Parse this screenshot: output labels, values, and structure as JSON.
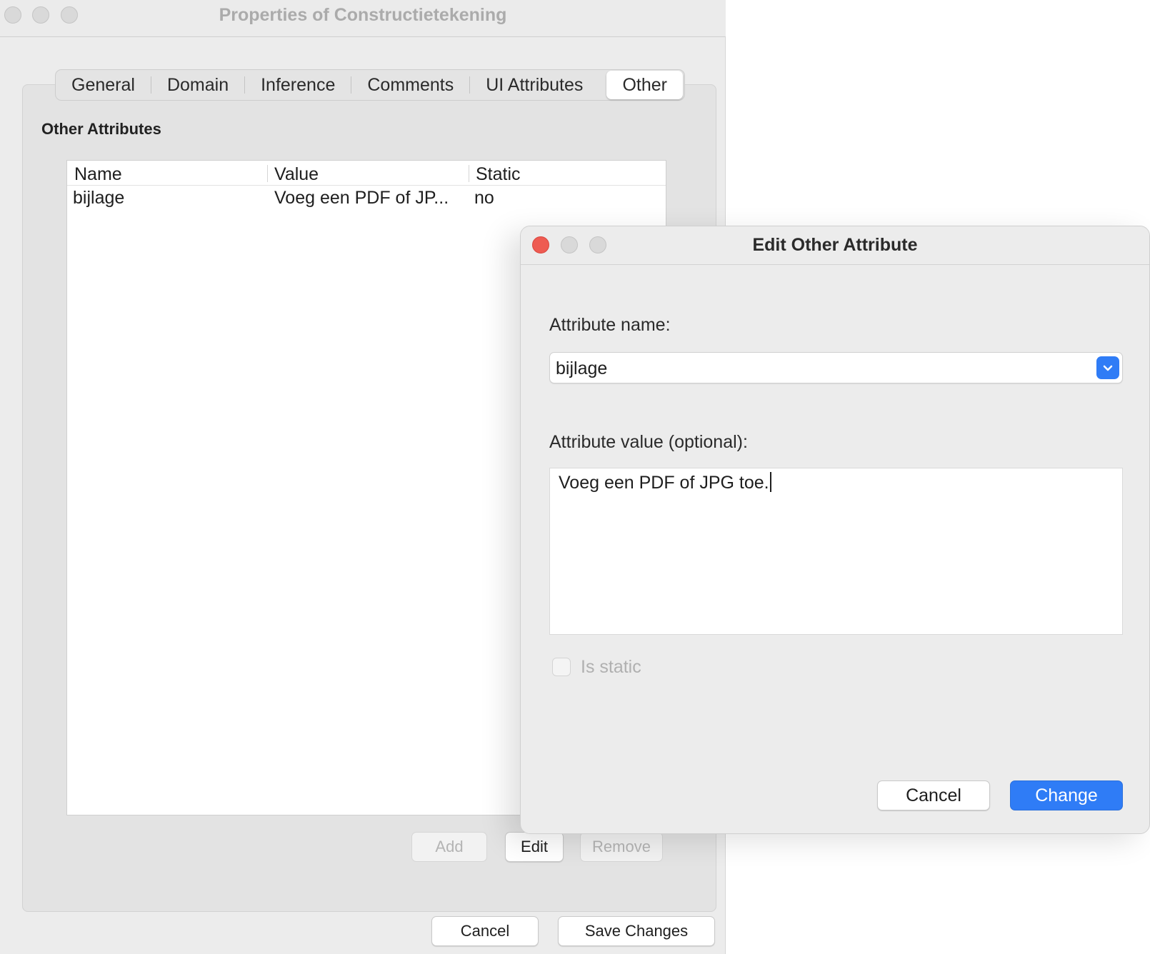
{
  "props_window": {
    "title": "Properties of Constructietekening",
    "tabs": [
      {
        "label": "General"
      },
      {
        "label": "Domain"
      },
      {
        "label": "Inference"
      },
      {
        "label": "Comments"
      },
      {
        "label": "UI Attributes"
      },
      {
        "label": "Other",
        "selected": true
      }
    ],
    "section_heading": "Other Attributes",
    "table": {
      "columns": [
        "Name",
        "Value",
        "Static"
      ],
      "rows": [
        {
          "name": "bijlage",
          "value": "Voeg een PDF of JP...",
          "static": "no"
        }
      ]
    },
    "buttons": {
      "add": "Add",
      "edit": "Edit",
      "remove": "Remove",
      "cancel": "Cancel",
      "save": "Save Changes"
    }
  },
  "dialog": {
    "title": "Edit Other Attribute",
    "name_label": "Attribute name:",
    "name_value": "bijlage",
    "value_label": "Attribute value (optional):",
    "value_text": "Voeg een PDF of JPG toe.",
    "is_static_label": "Is static",
    "is_static_checked": false,
    "cancel_label": "Cancel",
    "change_label": "Change"
  },
  "colors": {
    "accent": "#2f7cf6",
    "close_button": "#ee5b52",
    "window_bg": "#ececec"
  }
}
